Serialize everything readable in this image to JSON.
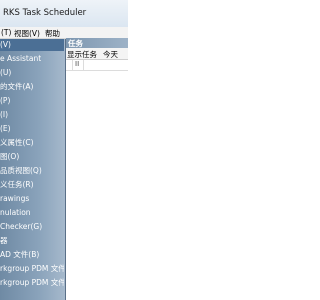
{
  "window": {
    "title": "RKS Task Scheduler"
  },
  "menubar": {
    "items": [
      "(T)",
      "视图(V)",
      "帮助"
    ]
  },
  "pane": {
    "header": "任务"
  },
  "toolbar": {
    "items": [
      "显示任务",
      "今天"
    ]
  },
  "list": {
    "column_glyph": "II"
  },
  "sidebar": {
    "items": [
      "(V)",
      "e Assistant",
      "(U)",
      "的文件(A)",
      "(P)",
      "(I)",
      "(E)",
      "义属性(C)",
      "图(O)",
      "品质视图(Q)",
      "义任务(R)",
      "rawings",
      "nulation",
      "Checker(G)",
      "器",
      "AD 文件(B)",
      "rkgroup PDM 文件",
      "rkgroup PDM 文件"
    ],
    "selected_index": 0
  }
}
